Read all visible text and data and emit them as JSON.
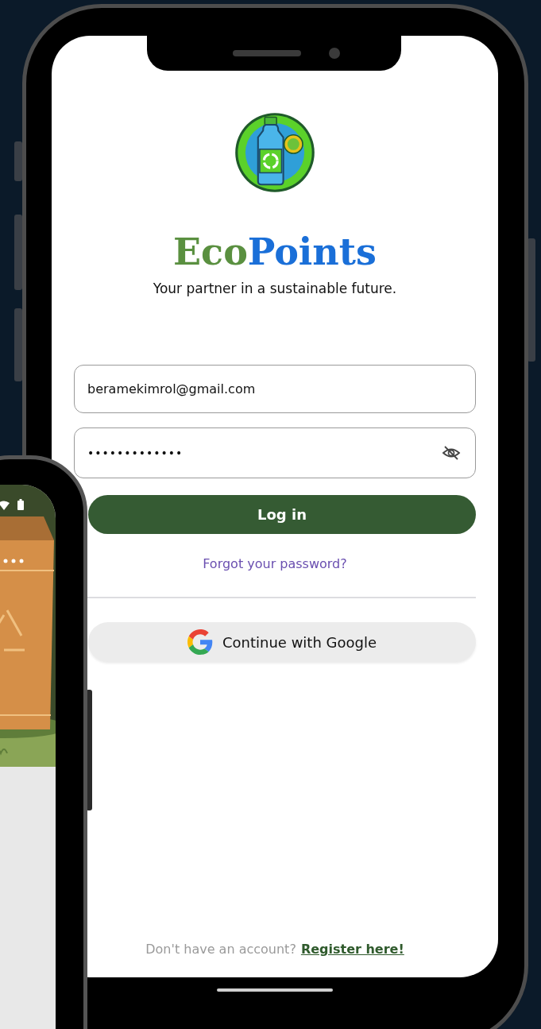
{
  "app": {
    "brand": [
      {
        "text": "Eco",
        "color": "#5a9040"
      },
      {
        "text": "Points",
        "color": "#1a6fd8"
      }
    ],
    "tagline": "Your partner in a sustainable future."
  },
  "email_field": {
    "value": "beramekimrol@gmail.com"
  },
  "password_field": {
    "value": "•••••••••••••",
    "masked": true
  },
  "login_button": {
    "label": "Log in"
  },
  "forgot_link": "Forgot your password?",
  "google_button": {
    "label": "Continue with Google"
  },
  "footer": {
    "text": "Don't have an account?",
    "link": "Register here!"
  }
}
